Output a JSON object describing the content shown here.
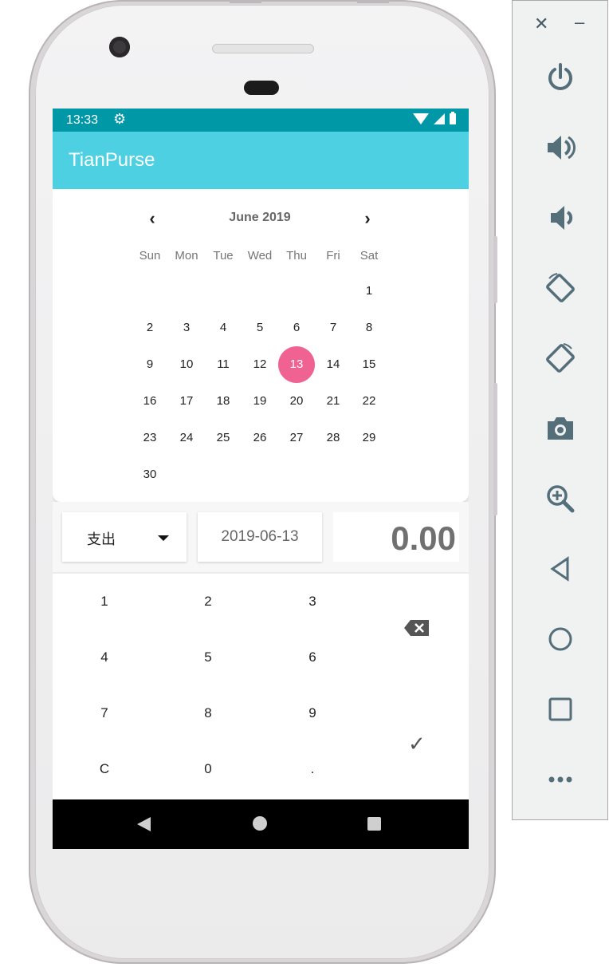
{
  "status_bar": {
    "time": "13:33",
    "settings_icon": "gear-icon"
  },
  "app": {
    "title": "TianPurse"
  },
  "calendar": {
    "month_label": "June 2019",
    "prev_icon": "chevron-left-icon",
    "next_icon": "chevron-right-icon",
    "weekdays": [
      "Sun",
      "Mon",
      "Tue",
      "Wed",
      "Thu",
      "Fri",
      "Sat"
    ],
    "days": [
      "1",
      "2",
      "3",
      "4",
      "5",
      "6",
      "7",
      "8",
      "9",
      "10",
      "11",
      "12",
      "13",
      "14",
      "15",
      "16",
      "17",
      "18",
      "19",
      "20",
      "21",
      "22",
      "23",
      "24",
      "25",
      "26",
      "27",
      "28",
      "29",
      "30"
    ],
    "selected_day": "13",
    "accent_color": "#f06292"
  },
  "entry": {
    "type_label": "支出",
    "date": "2019-06-13",
    "amount": "0.00"
  },
  "keypad": {
    "keys": [
      "1",
      "2",
      "3",
      "4",
      "5",
      "6",
      "7",
      "8",
      "9",
      "C",
      "0",
      "."
    ],
    "backspace_icon": "backspace-icon",
    "confirm_icon": "check-icon"
  },
  "toolbar": {
    "items": [
      "power-icon",
      "volume-up-icon",
      "volume-down-icon",
      "rotate-left-icon",
      "rotate-right-icon",
      "camera-icon",
      "zoom-icon",
      "back-icon",
      "home-icon",
      "overview-icon",
      "more-icon"
    ]
  },
  "colors": {
    "status_bar": "#0097a7",
    "app_bar": "#4dd0e1",
    "icon": "#546e7a"
  }
}
